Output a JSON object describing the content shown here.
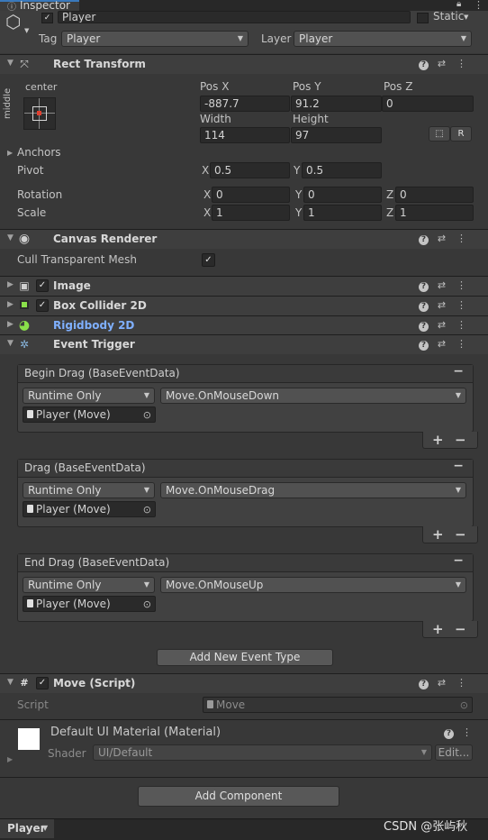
{
  "tab": {
    "title": "Inspector"
  },
  "object": {
    "name": "Player",
    "static_label": "Static",
    "tag_label": "Tag",
    "tag_value": "Player",
    "layer_label": "Layer",
    "layer_value": "Player"
  },
  "rect_transform": {
    "title": "Rect Transform",
    "anchor_h": "center",
    "anchor_v": "middle",
    "pos_x_label": "Pos X",
    "pos_x": "-887.7",
    "pos_y_label": "Pos Y",
    "pos_y": "91.2",
    "pos_z_label": "Pos Z",
    "pos_z": "0",
    "width_label": "Width",
    "width": "114",
    "height_label": "Height",
    "height": "97",
    "r_button": "R",
    "anchors_label": "Anchors",
    "pivot_label": "Pivot",
    "pivot_x_label": "X",
    "pivot_x": "0.5",
    "pivot_y_label": "Y",
    "pivot_y": "0.5",
    "rotation_label": "Rotation",
    "rot_x": "0",
    "rot_y": "0",
    "rot_z": "0",
    "scale_label": "Scale",
    "scale_x": "1",
    "scale_y": "1",
    "scale_z": "1",
    "x": "X",
    "y": "Y",
    "z": "Z"
  },
  "canvas_renderer": {
    "title": "Canvas Renderer",
    "cull_label": "Cull Transparent Mesh"
  },
  "image": {
    "title": "Image"
  },
  "box_collider": {
    "title": "Box Collider 2D"
  },
  "rigidbody": {
    "title": "Rigidbody 2D",
    "color": "#7fb0ff"
  },
  "event_trigger": {
    "title": "Event Trigger",
    "entries": [
      {
        "header": "Begin Drag (BaseEventData)",
        "mode": "Runtime Only",
        "function": "Move.OnMouseDown",
        "target": "Player (Move)"
      },
      {
        "header": "Drag (BaseEventData)",
        "mode": "Runtime Only",
        "function": "Move.OnMouseDrag",
        "target": "Player (Move)"
      },
      {
        "header": "End Drag (BaseEventData)",
        "mode": "Runtime Only",
        "function": "Move.OnMouseUp",
        "target": "Player (Move)"
      }
    ],
    "add_button": "Add New Event Type"
  },
  "move_script": {
    "title": "Move (Script)",
    "script_label": "Script",
    "script_value": "Move"
  },
  "material": {
    "title": "Default UI Material (Material)",
    "shader_label": "Shader",
    "shader_value": "UI/Default",
    "edit_button": "Edit..."
  },
  "add_component": "Add Component",
  "footer": {
    "selection": "Player",
    "watermark": "CSDN @张屿秋"
  },
  "icons": {
    "help": "?",
    "presets": "⇄",
    "more": "⋮",
    "minus": "−",
    "plus": "+"
  }
}
